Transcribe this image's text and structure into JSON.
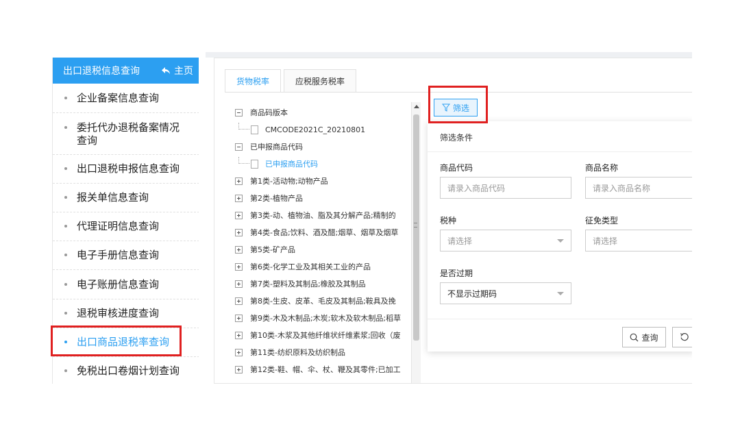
{
  "sidebar": {
    "title": "出口退税信息查询",
    "home": "主页",
    "items": [
      {
        "label": "企业备案信息查询"
      },
      {
        "label": "委托代办退税备案情况\n查询"
      },
      {
        "label": "出口退税申报信息查询"
      },
      {
        "label": "报关单信息查询"
      },
      {
        "label": "代理证明信息查询"
      },
      {
        "label": "电子手册信息查询"
      },
      {
        "label": "电子账册信息查询"
      },
      {
        "label": "退税审核进度查询"
      },
      {
        "label": "出口商品退税率查询"
      },
      {
        "label": "免税出口卷烟计划查询"
      }
    ],
    "active_index": 8
  },
  "tabs": [
    {
      "label": "货物税率"
    },
    {
      "label": "应税服务税率"
    }
  ],
  "tree": {
    "nodes": [
      {
        "label": "商品码版本"
      },
      {
        "label": "CMCODE2021C_20210801"
      },
      {
        "label": "已申报商品代码"
      },
      {
        "label": "已申报商品代码"
      },
      {
        "label": "第1类-活动物;动物产品"
      },
      {
        "label": "第2类-植物产品"
      },
      {
        "label": "第3类-动、植物油、脂及其分解产品;精制的"
      },
      {
        "label": "第4类-食品;饮料、酒及醋;烟草、烟草及烟草"
      },
      {
        "label": "第5类-矿产品"
      },
      {
        "label": "第6类-化学工业及其相关工业的产品"
      },
      {
        "label": "第7类-塑料及其制品;橡胶及其制品"
      },
      {
        "label": "第8类-生皮、皮革、毛皮及其制品;鞍具及挽"
      },
      {
        "label": "第9类-木及木制品;木炭;软木及软木制品;稻草"
      },
      {
        "label": "第10类-木浆及其他纤维状纤维素浆;回收（废"
      },
      {
        "label": "第11类-纺织原料及纺织制品"
      },
      {
        "label": "第12类-鞋、帽、伞、杖、鞭及其零件;已加工"
      }
    ]
  },
  "filter": {
    "button_label": "筛选",
    "title": "筛选条件",
    "fields": {
      "code": {
        "label": "商品代码",
        "placeholder": "请录入商品代码"
      },
      "name": {
        "label": "商品名称",
        "placeholder": "请录入商品名称"
      },
      "tax_type": {
        "label": "税种",
        "value": "请选择"
      },
      "exempt_type": {
        "label": "征免类型",
        "value": "请选择"
      },
      "expired": {
        "label": "是否过期",
        "value": "不显示过期码"
      }
    },
    "query_label": "查询"
  },
  "colors": {
    "accent": "#2c9ff1",
    "highlight": "#e02020"
  }
}
